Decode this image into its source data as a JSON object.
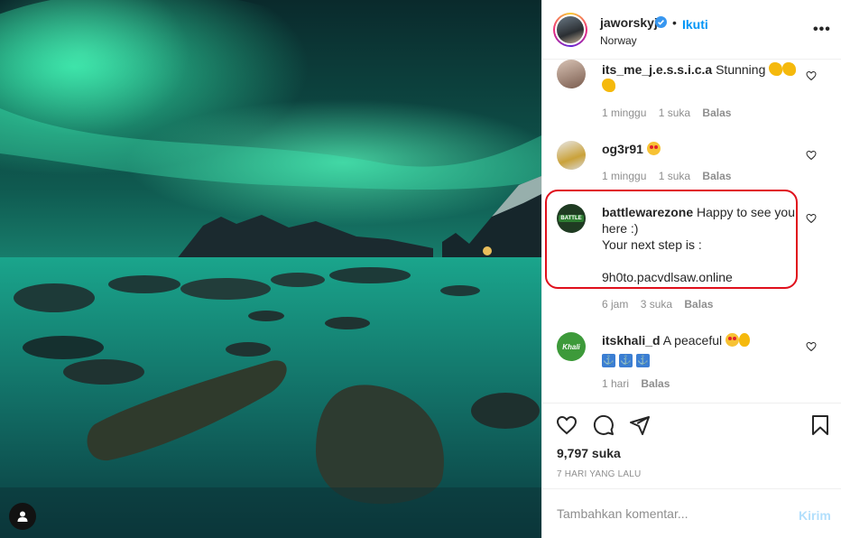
{
  "post": {
    "username": "jaworskyj",
    "follow_label": "Ikuti",
    "separator": "•",
    "location": "Norway",
    "more_label": "•••"
  },
  "comments": [
    {
      "username": "its_me_j.e.s.s.i.c.a",
      "text": "Stunning",
      "emojis": [
        "clap",
        "clap",
        "clap"
      ],
      "time": "1 minggu",
      "likes": "1 suka",
      "reply": "Balas"
    },
    {
      "username": "og3r91",
      "text": "",
      "emojis": [
        "heart-eyes"
      ],
      "time": "1 minggu",
      "likes": "1 suka",
      "reply": "Balas"
    },
    {
      "username": "battlewarezone",
      "text_line1": "Happy to see you",
      "text_line2": "here :)",
      "text_line3": "Your next step is :",
      "link": "9h0to.pacvdlsaw.online",
      "time": "6 jam",
      "likes": "3 suka",
      "reply": "Balas",
      "avatar_label": "BATTLE"
    },
    {
      "username": "itskhali_d",
      "text": "A peaceful",
      "emojis": [
        "heart-eyes",
        "ok-hand",
        "anchor",
        "anchor",
        "anchor"
      ],
      "time": "1 hari",
      "reply": "Balas",
      "avatar_label": "Khali"
    }
  ],
  "stats": {
    "likes": "9,797 suka",
    "posted": "7 HARI YANG LALU"
  },
  "composer": {
    "placeholder": "Tambahkan komentar...",
    "send_label": "Kirim"
  },
  "colors": {
    "accent": "#0095f6",
    "highlight": "#e0101c",
    "aurora": "#1fd39a"
  }
}
